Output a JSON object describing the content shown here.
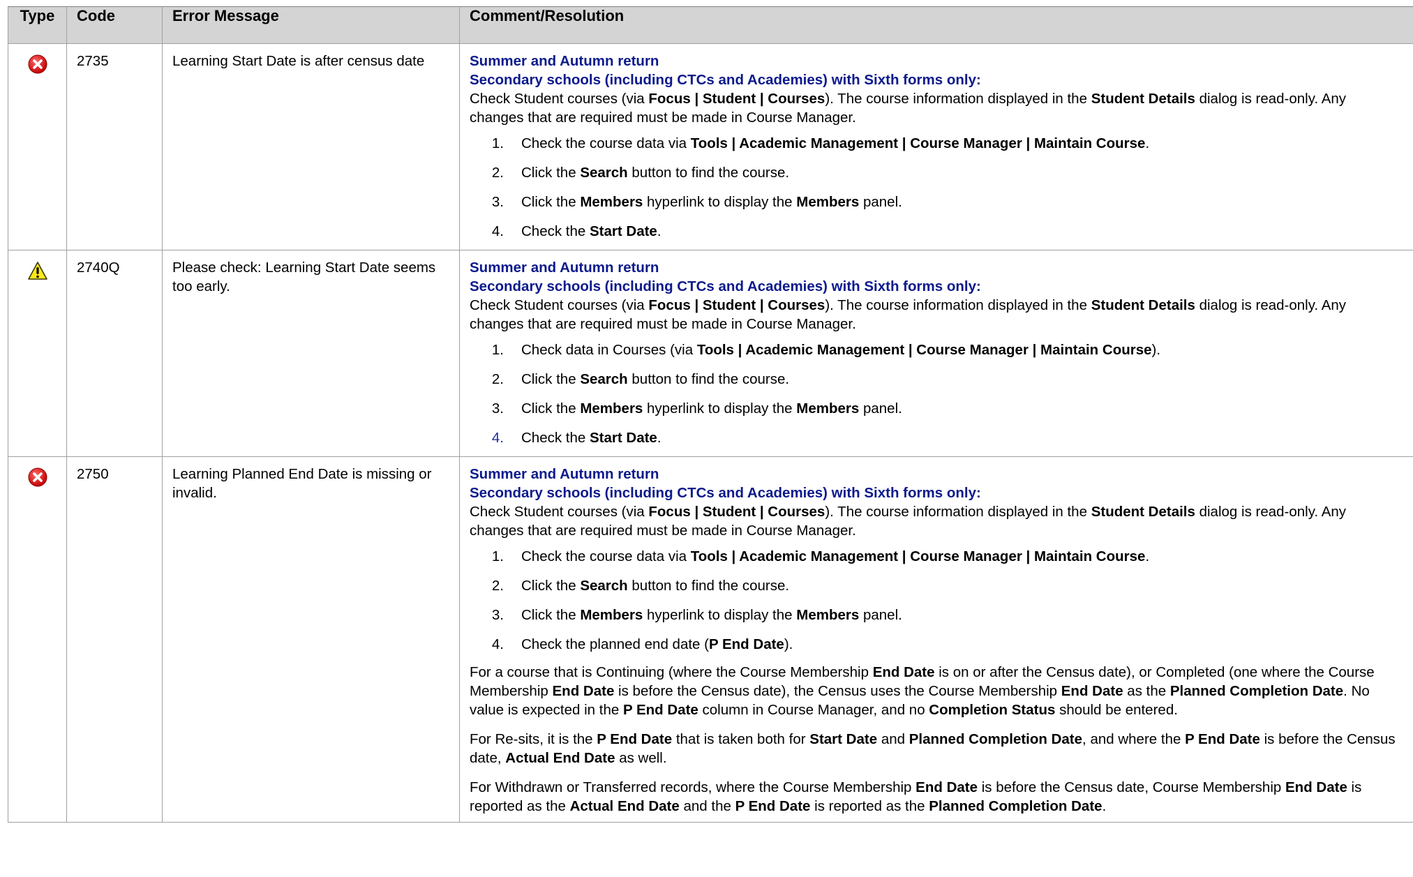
{
  "headers": {
    "type": "Type",
    "code": "Code",
    "message": "Error Message",
    "comment": "Comment/Resolution"
  },
  "rows": [
    {
      "icon": "error-icon",
      "code": "2735",
      "message": "Learning Start Date is after census date",
      "heading1": "Summer and Autumn return",
      "heading2": "Secondary schools (including CTCs and Academies) with Sixth forms only:",
      "intro": [
        {
          "t": "Check Student courses (via "
        },
        {
          "t": "Focus | Student | Courses",
          "b": true
        },
        {
          "t": "). The course information displayed in the "
        },
        {
          "t": "Student Details",
          "b": true
        },
        {
          "t": " dialog is read-only. Any changes that are required must be made in Course Manager."
        }
      ],
      "steps": [
        {
          "num": "1.",
          "parts": [
            {
              "t": "Check the course data via "
            },
            {
              "t": "Tools | Academic Management | Course Manager | Maintain Course",
              "b": true
            },
            {
              "t": "."
            }
          ]
        },
        {
          "num": "2.",
          "parts": [
            {
              "t": "Click the "
            },
            {
              "t": "Search",
              "b": true
            },
            {
              "t": " button to find the course."
            }
          ]
        },
        {
          "num": "3.",
          "parts": [
            {
              "t": "Click the "
            },
            {
              "t": "Members",
              "b": true
            },
            {
              "t": " hyperlink to display the "
            },
            {
              "t": "Members",
              "b": true
            },
            {
              "t": " panel."
            }
          ]
        },
        {
          "num": "4.",
          "parts": [
            {
              "t": "Check the "
            },
            {
              "t": "Start Date",
              "b": true
            },
            {
              "t": "."
            }
          ]
        }
      ],
      "extra": []
    },
    {
      "icon": "warning-icon",
      "code": "2740Q",
      "message": "Please check: Learning Start Date seems too early.",
      "heading1": "Summer and Autumn return",
      "heading2": "Secondary schools (including CTCs and Academies) with Sixth forms only:",
      "intro": [
        {
          "t": "Check Student courses (via "
        },
        {
          "t": "Focus | Student | Courses",
          "b": true
        },
        {
          "t": "). The course information displayed in the "
        },
        {
          "t": "Student Details",
          "b": true
        },
        {
          "t": " dialog is read-only. Any changes that are required must be made in Course Manager."
        }
      ],
      "steps": [
        {
          "num": "1.",
          "parts": [
            {
              "t": "Check data in Courses (via "
            },
            {
              "t": "Tools | Academic Management | Course Manager | Maintain Course",
              "b": true
            },
            {
              "t": ")."
            }
          ]
        },
        {
          "num": "2.",
          "parts": [
            {
              "t": "Click the "
            },
            {
              "t": "Search",
              "b": true
            },
            {
              "t": " button to find the course."
            }
          ]
        },
        {
          "num": "3.",
          "parts": [
            {
              "t": "Click the "
            },
            {
              "t": "Members",
              "b": true
            },
            {
              "t": " hyperlink to display the "
            },
            {
              "t": "Members",
              "b": true
            },
            {
              "t": " panel."
            }
          ]
        },
        {
          "num": "4.",
          "blue": true,
          "parts": [
            {
              "t": "Check the "
            },
            {
              "t": "Start Date",
              "b": true
            },
            {
              "t": "."
            }
          ]
        }
      ],
      "extra": []
    },
    {
      "icon": "error-icon",
      "code": "2750",
      "message": "Learning Planned End Date is missing or invalid.",
      "heading1": "Summer and Autumn return",
      "heading2": "Secondary schools (including CTCs and Academies) with Sixth forms only:",
      "intro": [
        {
          "t": "Check Student courses (via "
        },
        {
          "t": "Focus | Student | Courses",
          "b": true
        },
        {
          "t": "). The course information displayed in the "
        },
        {
          "t": "Student Details",
          "b": true
        },
        {
          "t": " dialog is read-only. Any changes that are required must be made in Course Manager."
        }
      ],
      "steps": [
        {
          "num": "1.",
          "parts": [
            {
              "t": "Check the course data via "
            },
            {
              "t": "Tools | Academic Management | Course Manager | Maintain Course",
              "b": true
            },
            {
              "t": "."
            }
          ]
        },
        {
          "num": "2.",
          "parts": [
            {
              "t": "Click the "
            },
            {
              "t": "Search",
              "b": true
            },
            {
              "t": " button to find the course."
            }
          ]
        },
        {
          "num": "3.",
          "parts": [
            {
              "t": "Click the "
            },
            {
              "t": "Members",
              "b": true
            },
            {
              "t": " hyperlink to display the "
            },
            {
              "t": "Members",
              "b": true
            },
            {
              "t": " panel."
            }
          ]
        },
        {
          "num": "4.",
          "parts": [
            {
              "t": "Check the planned end date ("
            },
            {
              "t": "P End Date",
              "b": true
            },
            {
              "t": ")."
            }
          ]
        }
      ],
      "extra": [
        [
          {
            "t": "For a course that is Continuing (where the Course Membership "
          },
          {
            "t": "End Date",
            "b": true
          },
          {
            "t": " is on or after the Census date), or Completed (one where the Course Membership "
          },
          {
            "t": "End Date",
            "b": true
          },
          {
            "t": " is before the Census date), the Census uses the Course Membership "
          },
          {
            "t": "End Date",
            "b": true
          },
          {
            "t": " as the "
          },
          {
            "t": "Planned Completion Date",
            "b": true
          },
          {
            "t": ". No value is expected in the "
          },
          {
            "t": "P End Date",
            "b": true
          },
          {
            "t": " column in Course Manager, and no "
          },
          {
            "t": "Completion Status",
            "b": true
          },
          {
            "t": " should be entered."
          }
        ],
        [
          {
            "t": "For Re-sits, it is the "
          },
          {
            "t": "P End Date",
            "b": true
          },
          {
            "t": " that is taken both for "
          },
          {
            "t": "Start Date",
            "b": true
          },
          {
            "t": " and "
          },
          {
            "t": "Planned Completion Date",
            "b": true
          },
          {
            "t": ", and where the "
          },
          {
            "t": "P End Date",
            "b": true
          },
          {
            "t": " is before the Census date, "
          },
          {
            "t": "Actual End Date",
            "b": true
          },
          {
            "t": " as well."
          }
        ],
        [
          {
            "t": "For Withdrawn or Transferred records, where the Course Membership "
          },
          {
            "t": "End Date",
            "b": true
          },
          {
            "t": " is before the Census date, Course Membership "
          },
          {
            "t": "End Date",
            "b": true
          },
          {
            "t": " is reported as the "
          },
          {
            "t": "Actual End Date",
            "b": true
          },
          {
            "t": " and the "
          },
          {
            "t": "P End Date",
            "b": true
          },
          {
            "t": " is reported as the "
          },
          {
            "t": "Planned Completion Date",
            "b": true
          },
          {
            "t": "."
          }
        ]
      ]
    }
  ]
}
